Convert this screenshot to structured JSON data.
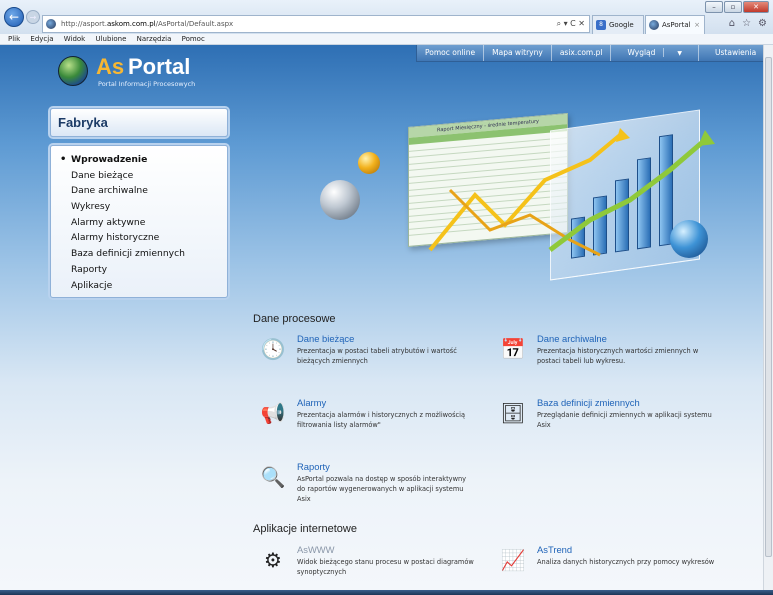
{
  "browser": {
    "address": "http://asport.askom.com.pl/AsPortal/Default.aspx",
    "address_prefix": "http://asport.",
    "address_host": "askom.com.pl",
    "address_path": "/AsPortal/Default.aspx",
    "address_tools": "⌕ ▾ C ✕",
    "tabs": [
      {
        "label": "Google",
        "icon": "google-icon"
      },
      {
        "label": "AsPortal",
        "icon": "asportal-globe-icon"
      }
    ],
    "menu": [
      "Plik",
      "Edycja",
      "Widok",
      "Ulubione",
      "Narzędzia",
      "Pomoc"
    ]
  },
  "topnav": {
    "items": [
      "Pomoc online",
      "Mapa witryny",
      "asix.com.pl",
      "Wygląd",
      "Ustawienia"
    ]
  },
  "logo": {
    "as": "As",
    "portal": "Portal",
    "subtitle": "Portal Informacji Procesowych"
  },
  "sidebar": {
    "title": "Fabryka",
    "items": [
      "Wprowadzenie",
      "Dane bieżące",
      "Dane archiwalne",
      "Wykresy",
      "Alarmy aktywne",
      "Alarmy historyczne",
      "Baza definicji zmiennych",
      "Raporty",
      "Aplikacje"
    ],
    "active_index": 0
  },
  "hero": {
    "sheet_title": "Raport Miesięczny - średnie temperatury"
  },
  "sections": {
    "dane_procesowe": "Dane procesowe",
    "aplikacje_internetowe": "Aplikacje internetowe"
  },
  "cards": {
    "dane_biezace": {
      "title": "Dane bieżące",
      "desc": "Prezentacja w postaci tabeli atrybutów i wartość bieżących zmiennych"
    },
    "dane_archiwalne": {
      "title": "Dane archiwalne",
      "desc": "Prezentacja historycznych wartości zmiennych w postaci tabeli lub wykresu."
    },
    "alarmy": {
      "title": "Alarmy",
      "desc": "Prezentacja alarmów i historycznych z możliwością filtrowania listy alarmów\""
    },
    "baza": {
      "title": "Baza definicji zmiennych",
      "desc": "Przeglądanie definicji zmiennych w aplikacji systemu Asix"
    },
    "raporty": {
      "title": "Raporty",
      "desc": "AsPortal pozwala na dostęp w sposób interaktywny do raportów wygenerowanych w aplikacji systemu Asix"
    },
    "aswww": {
      "title": "AsWWW",
      "desc": "Widok bieżącego stanu procesu w postaci diagramów synoptycznych"
    },
    "astrend": {
      "title": "AsTrend",
      "desc": "Analiza danych historycznych przy pomocy wykresów"
    }
  }
}
